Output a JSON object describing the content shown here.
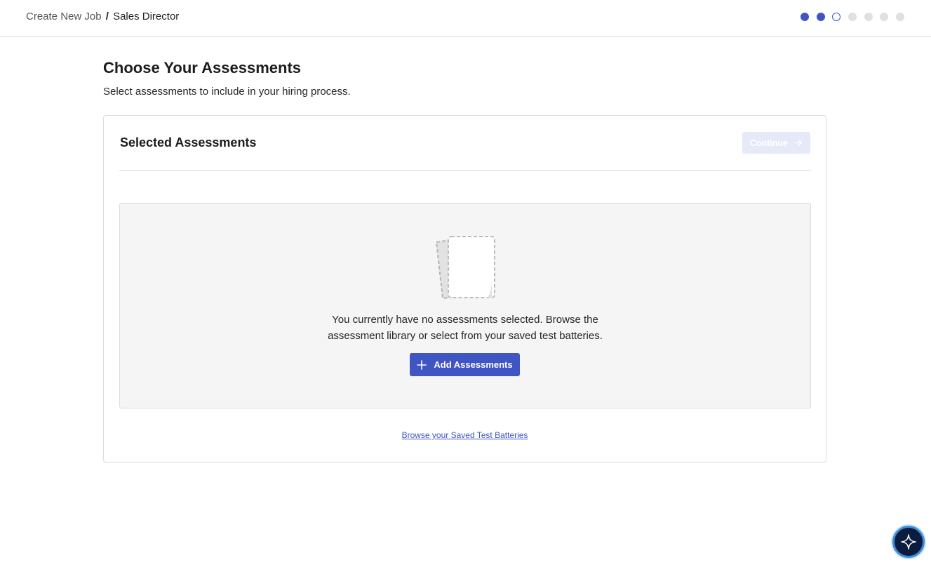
{
  "header": {
    "breadcrumb_parent": "Create New Job",
    "breadcrumb_separator": "/",
    "breadcrumb_current": "Sales Director",
    "steps": [
      "done",
      "done",
      "current",
      "todo",
      "todo",
      "todo",
      "todo"
    ]
  },
  "main": {
    "title": "Choose Your Assessments",
    "subtitle": "Select assessments to include in your hiring process."
  },
  "card": {
    "title": "Selected Assessments",
    "continue_label": "Continue",
    "continue_icon": "arrow-right-icon",
    "empty_line_1": "You currently have no assessments selected. Browse the",
    "empty_line_2": "assessment library or select from your saved test batteries.",
    "add_label": "Add Assessments",
    "add_icon": "plus-icon",
    "browse_link": "Browse your Saved Test Batteries"
  },
  "assistant_button": {
    "icon": "sparkle-icon"
  },
  "colors": {
    "accent": "#3f55c4",
    "disabled_button": "#e6e9f8",
    "empty_bg": "#f5f5f5",
    "border": "#dcdcdc"
  }
}
